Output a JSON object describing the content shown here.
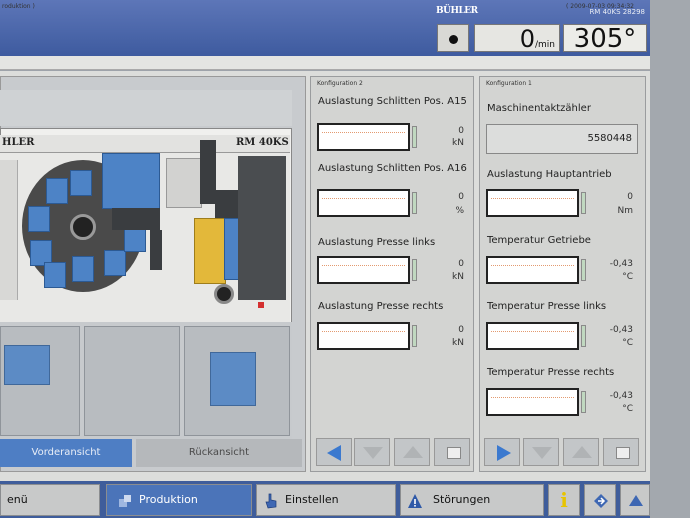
{
  "header": {
    "brand": "BÜHLER",
    "model_info": "RM 40KS  28298",
    "machine_icon": "machine-status-icon",
    "rpm_value": "0",
    "rpm_unit": "/min",
    "angle_value": "305°"
  },
  "status_strip": {
    "left_text": "roduktion )",
    "right_text": "( 2009-07-03 09:34:32"
  },
  "machine_view": {
    "logo": "HLER",
    "model": "RM 40KS",
    "tabs": [
      {
        "label": "Vorderansicht",
        "active": true
      },
      {
        "label": "Rückansicht",
        "active": false
      }
    ]
  },
  "config2": {
    "title": "Konfiguration 2",
    "items": [
      {
        "label": "Auslastung Schlitten Pos. A15",
        "value": "0",
        "unit": "kN"
      },
      {
        "label": "Auslastung Schlitten Pos. A16",
        "value": "0",
        "unit": "%"
      },
      {
        "label": "Auslastung Presse links",
        "value": "0",
        "unit": "kN"
      },
      {
        "label": "Auslastung Presse rechts",
        "value": "0",
        "unit": "kN"
      }
    ]
  },
  "config1": {
    "title": "Konfiguration 1",
    "counter_label": "Maschinentaktzähler",
    "counter_value": "5580448",
    "items": [
      {
        "label": "Auslastung Hauptantrieb",
        "value": "0",
        "unit": "Nm"
      },
      {
        "label": "Temperatur Getriebe",
        "value": "-0,43",
        "unit": "°C"
      },
      {
        "label": "Temperatur Presse links",
        "value": "-0,43",
        "unit": "°C"
      },
      {
        "label": "Temperatur Presse rechts",
        "value": "-0,43",
        "unit": "°C"
      }
    ]
  },
  "bottom_nav": {
    "menu": "enü",
    "production": "Produktion",
    "settings": "Einstellen",
    "faults": "Störungen",
    "info": "i"
  },
  "colors": {
    "header_blue": "#4a67ad",
    "accent_blue": "#3b79cf",
    "active_tab": "#4e7ec4"
  }
}
